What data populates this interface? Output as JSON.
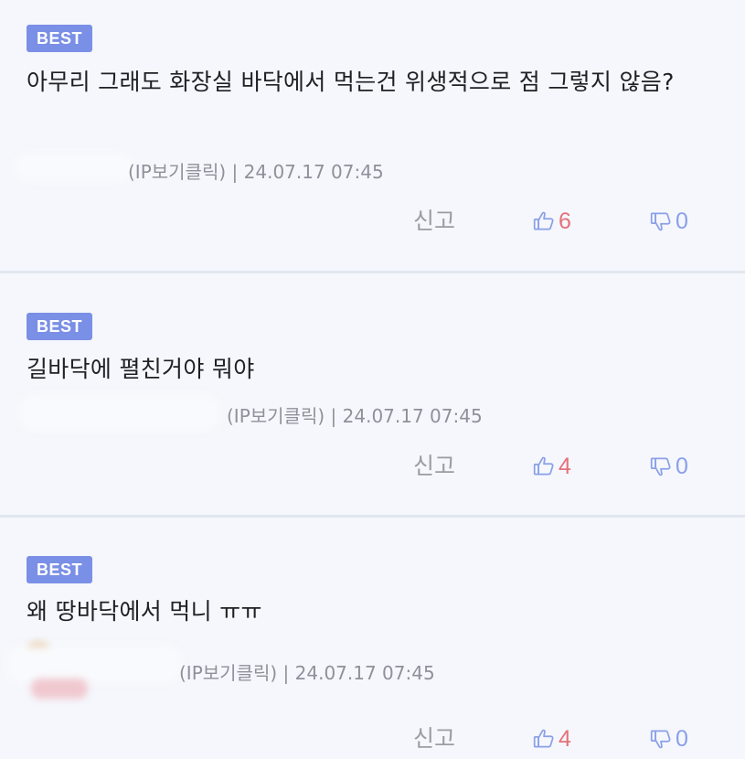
{
  "colors": {
    "background": "#f5f7fc",
    "badge": "#7a8fe6",
    "like_count": "#e5717a",
    "dislike_count": "#8aa0e8",
    "icon": "#8aa0e8"
  },
  "comments": [
    {
      "badge": "BEST",
      "text": "아무리 그래도 화장실 바닥에서 먹는건 위생적으로 점 그렇지 않음?",
      "ip_label": "(IP보기클릭)",
      "separator": "|",
      "datetime": "24.07.17 07:45",
      "report_label": "신고",
      "likes": "6",
      "dislikes": "0",
      "like_icon": "thumbs-up-icon",
      "dislike_icon": "thumbs-down-icon"
    },
    {
      "badge": "BEST",
      "text": "길바닥에 펼친거야 뭐야",
      "author_fragment": "​",
      "ip_label": "(IP보기클릭)",
      "separator": "|",
      "datetime": "24.07.17 07:45",
      "report_label": "신고",
      "likes": "4",
      "dislikes": "0",
      "like_icon": "thumbs-up-icon",
      "dislike_icon": "thumbs-down-icon"
    },
    {
      "badge": "BEST",
      "text": "왜 땅바닥에서 먹니 ㅠㅠ",
      "ip_label": "(IP보기클릭)",
      "separator": "|",
      "datetime": "24.07.17 07:45",
      "report_label": "신고",
      "likes": "4",
      "dislikes": "0",
      "like_icon": "thumbs-up-icon",
      "dislike_icon": "thumbs-down-icon"
    }
  ]
}
